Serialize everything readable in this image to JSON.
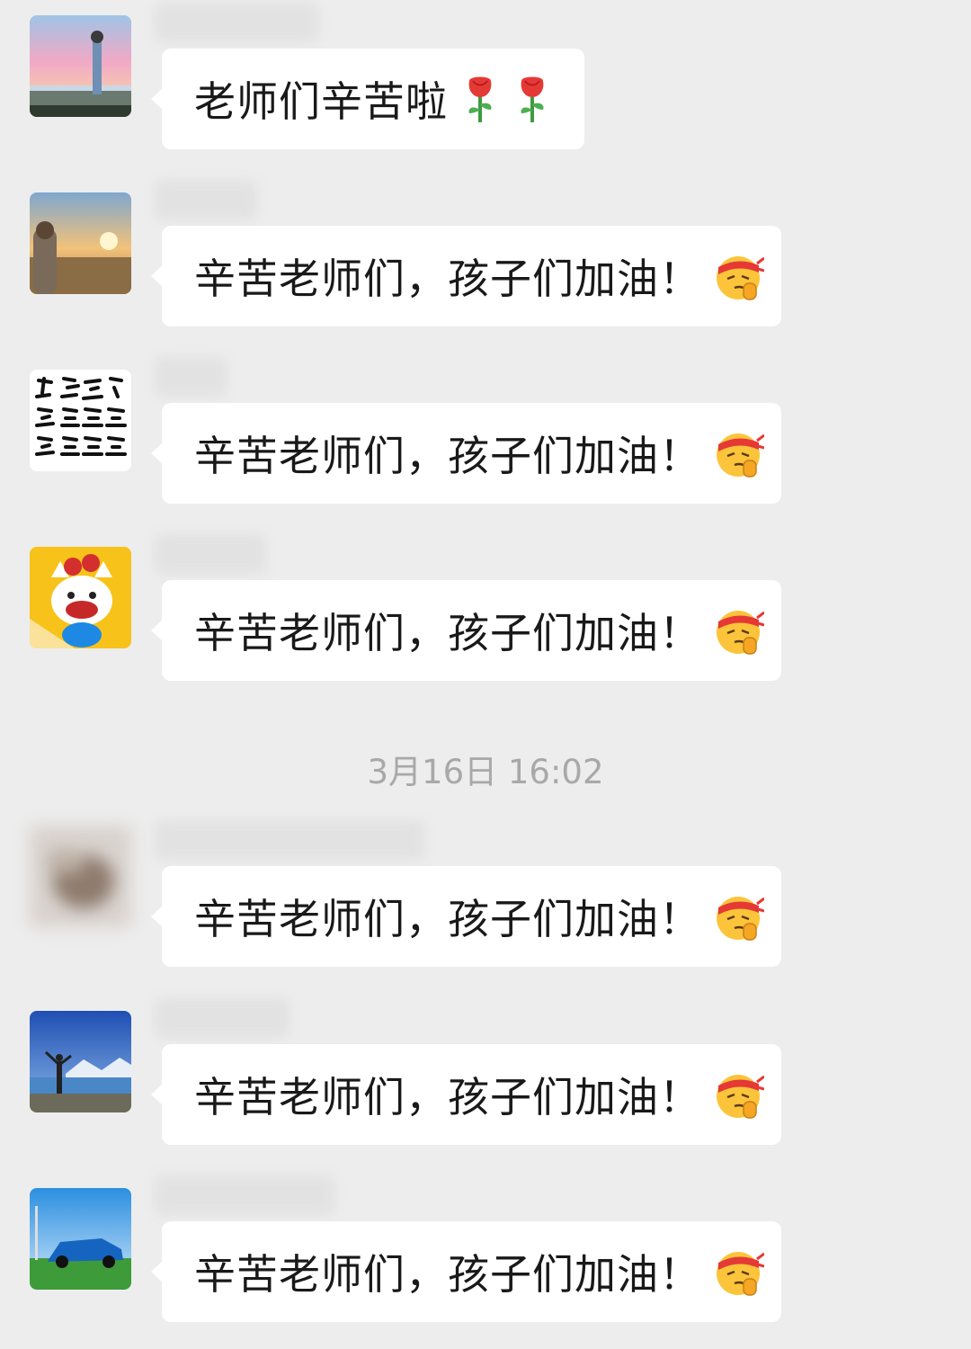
{
  "messages": [
    {
      "text": "老师们辛苦啦",
      "emoji": [
        "rose-icon",
        "rose-icon"
      ]
    },
    {
      "text": "辛苦老师们，孩子们加油！",
      "emoji": [
        "fighting-face-icon"
      ]
    },
    {
      "text": "辛苦老师们，孩子们加油！",
      "emoji": [
        "fighting-face-icon"
      ]
    },
    {
      "text": "辛苦老师们，孩子们加油！",
      "emoji": [
        "fighting-face-icon"
      ]
    },
    {
      "text": "辛苦老师们，孩子们加油！",
      "emoji": [
        "fighting-face-icon"
      ]
    },
    {
      "text": "辛苦老师们，孩子们加油！",
      "emoji": [
        "fighting-face-icon"
      ]
    },
    {
      "text": "辛苦老师们，孩子们加油！",
      "emoji": [
        "fighting-face-icon"
      ]
    }
  ],
  "timestamp": "3月16日 16:02",
  "colors": {
    "background": "#ededed",
    "bubble": "#ffffff",
    "text": "#191919",
    "timestamp": "#a8a8a8"
  }
}
